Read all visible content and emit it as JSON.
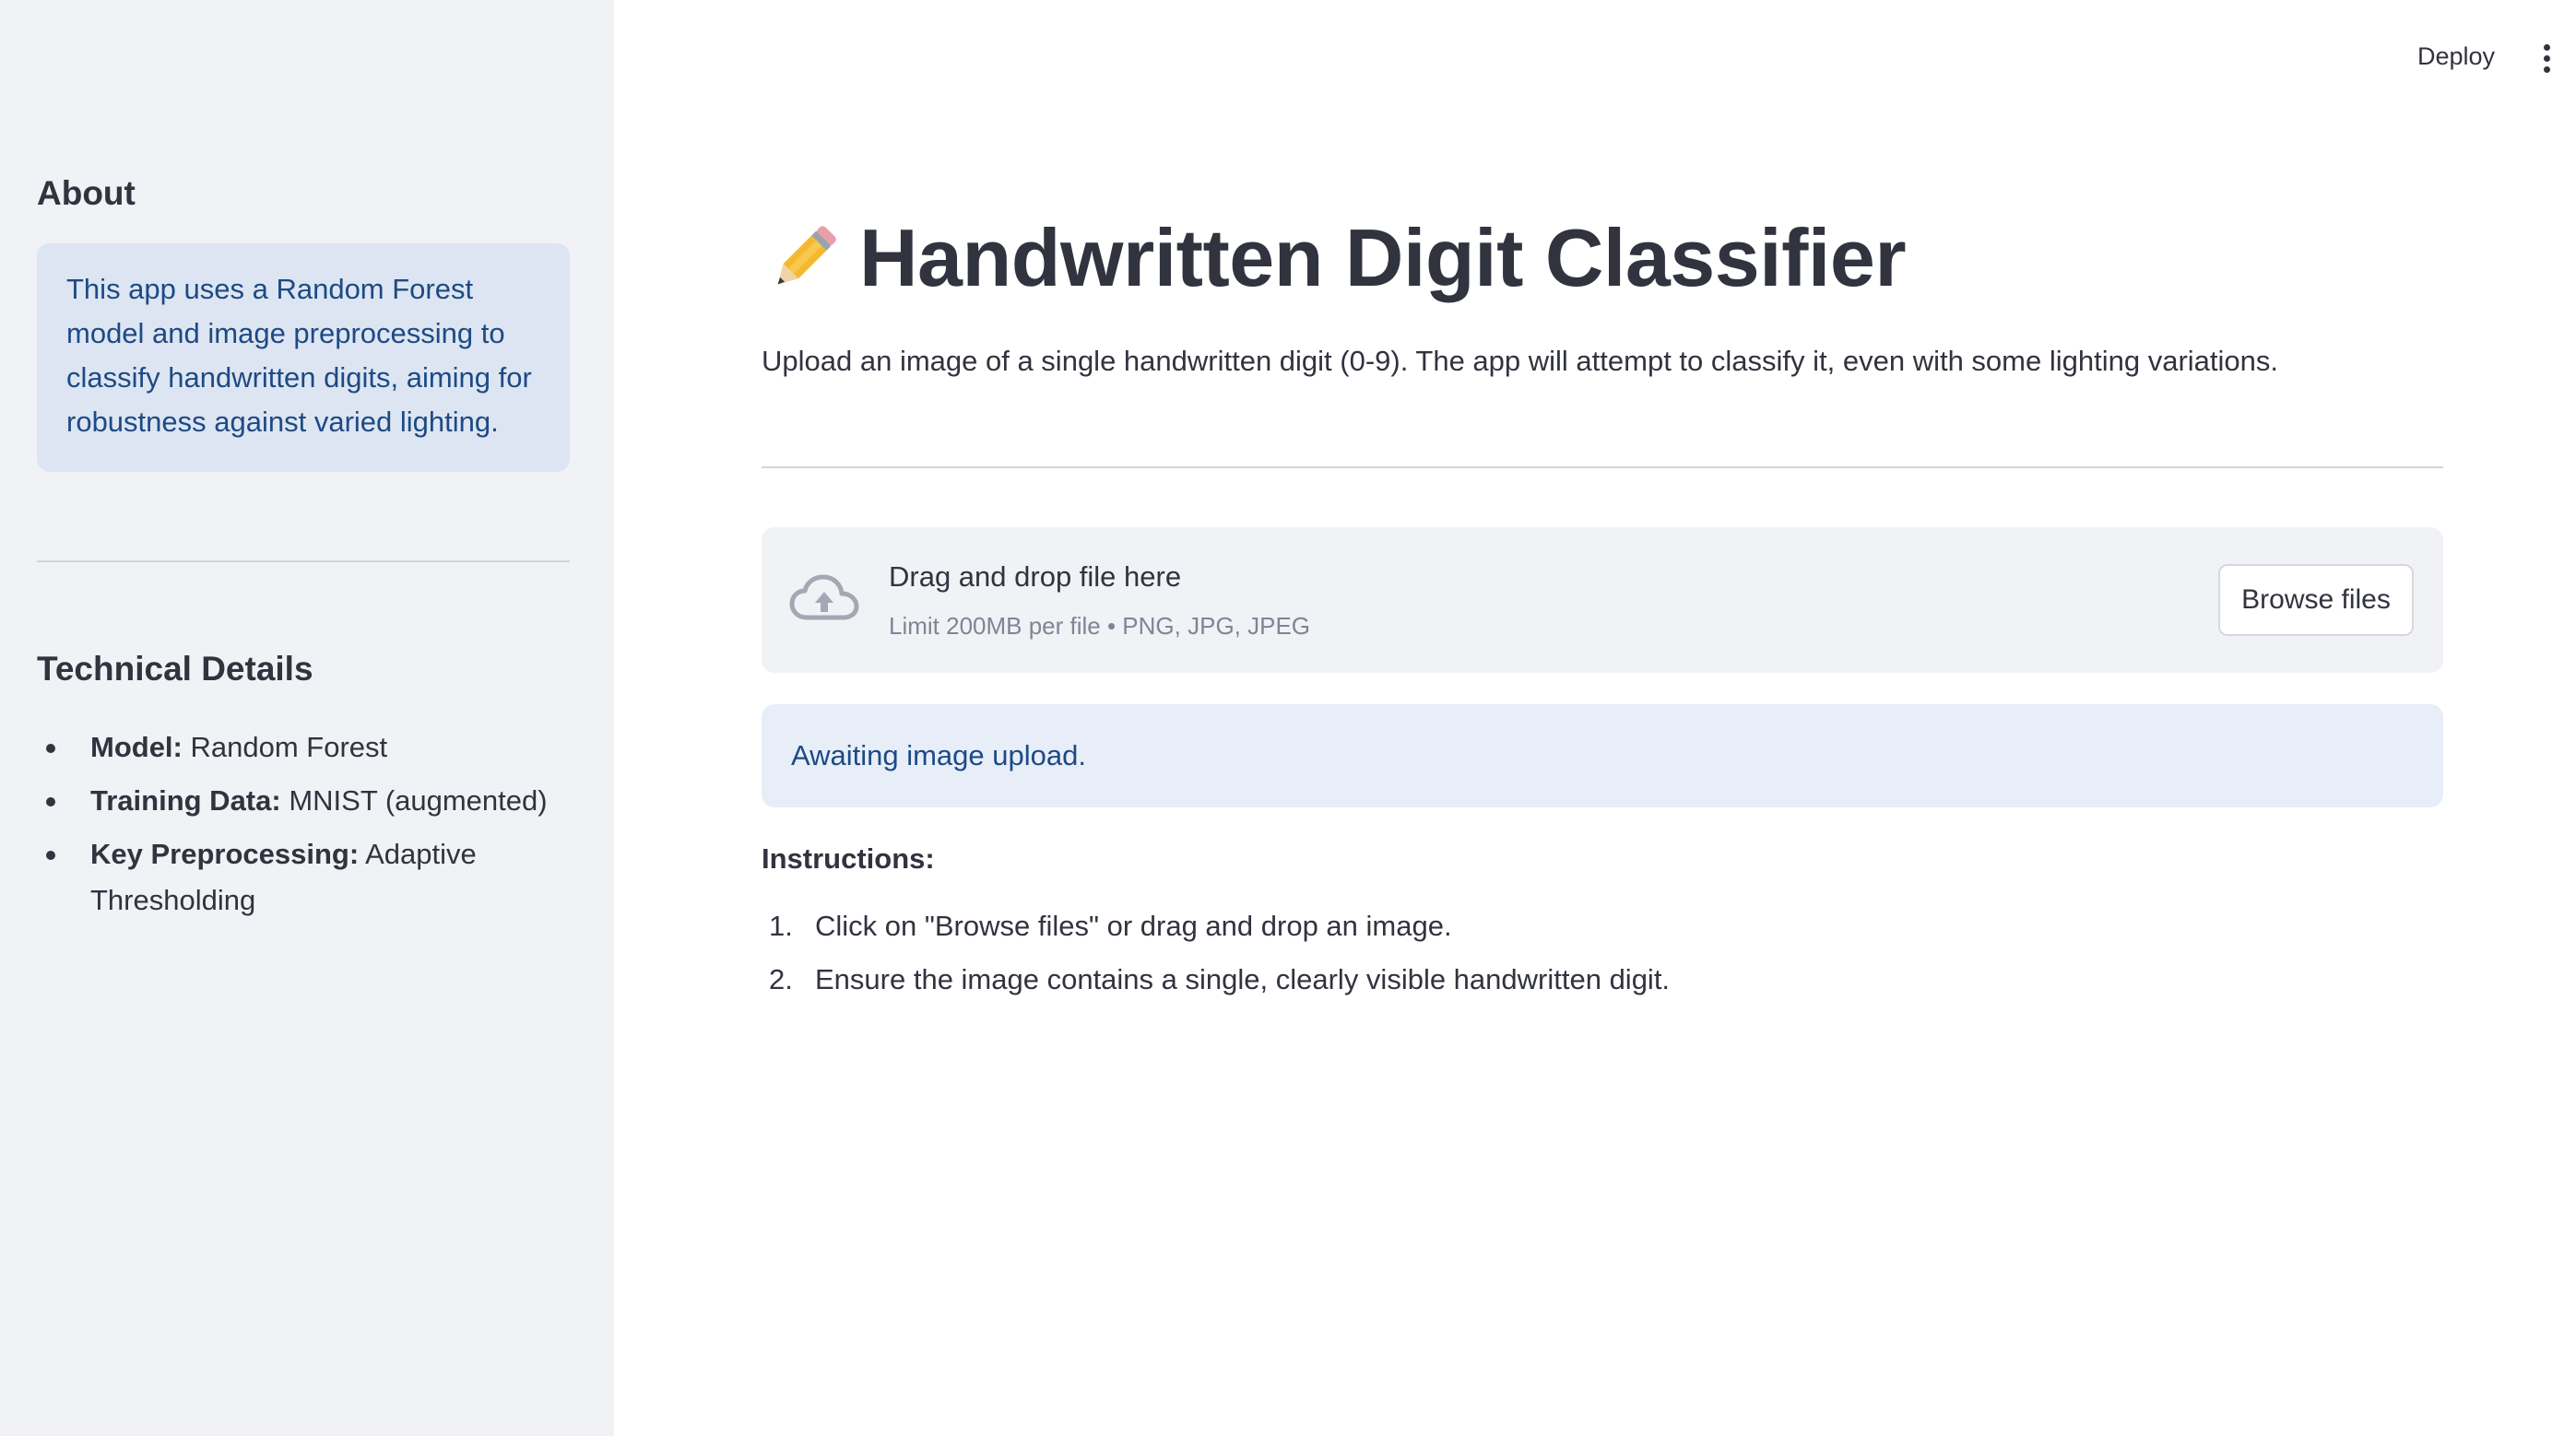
{
  "sidebar": {
    "about_title": "About",
    "about_text": "This app uses a Random Forest model and image preprocessing to classify handwritten digits, aiming for robustness against varied lighting.",
    "tech_title": "Technical Details",
    "tech_items": [
      {
        "label": "Model:",
        "value": "Random Forest"
      },
      {
        "label": "Training Data:",
        "value": "MNIST (augmented)"
      },
      {
        "label": "Key Preprocessing:",
        "value": "Adaptive Thresholding"
      }
    ]
  },
  "header": {
    "deploy_label": "Deploy",
    "menu_icon": "more-vertical-icon"
  },
  "main": {
    "title_icon": "pencil-icon",
    "title": "Handwritten Digit Classifier",
    "subtitle": "Upload an image of a single handwritten digit (0-9). The app will attempt to classify it, even with some lighting variations.",
    "uploader": {
      "icon": "cloud-upload-icon",
      "drag_text": "Drag and drop file here",
      "limit_text": "Limit 200MB per file • PNG, JPG, JPEG",
      "browse_label": "Browse files"
    },
    "info_text": "Awaiting image upload.",
    "instructions_title": "Instructions:",
    "instructions": [
      {
        "num": "1.",
        "text": "Click on \"Browse files\" or drag and drop an image."
      },
      {
        "num": "2.",
        "text": "Ensure the image contains a single, clearly visible handwritten digit."
      }
    ]
  },
  "colors": {
    "sidebar_bg": "#f0f2f6",
    "info_bg": "#e8eef8",
    "info_text": "#1d4a84",
    "text": "#31333f"
  }
}
